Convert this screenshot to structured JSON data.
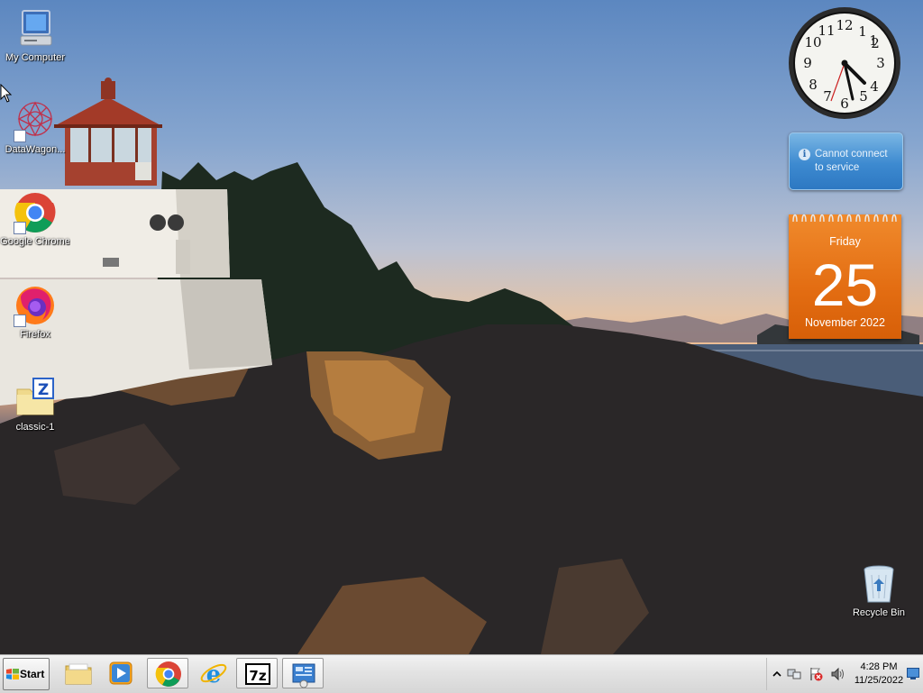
{
  "desktop": {
    "icons": [
      {
        "label": "My Computer",
        "icon": "computer-icon"
      },
      {
        "label": "DataWagon...",
        "icon": "datawagon-icon"
      },
      {
        "label": "Google Chrome",
        "icon": "chrome-icon"
      },
      {
        "label": "Firefox",
        "icon": "firefox-icon"
      },
      {
        "label": "classic-1",
        "icon": "zip-archive-icon"
      },
      {
        "label": "Recycle Bin",
        "icon": "recycle-bin-icon"
      }
    ]
  },
  "gadgets": {
    "clock": {
      "time": "4:28"
    },
    "weather": {
      "message": "Cannot connect to service",
      "icon": "info-icon"
    },
    "calendar": {
      "weekday": "Friday",
      "day": "25",
      "month_year": "November 2022"
    }
  },
  "taskbar": {
    "start_label": "Start",
    "pinned": [
      {
        "name": "Windows Explorer",
        "icon": "folder-icon"
      },
      {
        "name": "Windows Media Player",
        "icon": "media-player-icon"
      },
      {
        "name": "Google Chrome",
        "icon": "chrome-icon",
        "active": true
      },
      {
        "name": "Internet Explorer",
        "icon": "internet-explorer-icon"
      },
      {
        "name": "7-Zip",
        "icon": "sevenzip-icon",
        "active": true
      },
      {
        "name": "Control Panel",
        "icon": "control-panel-icon",
        "active": true
      }
    ],
    "tray": {
      "time": "4:28 PM",
      "date": "11/25/2022",
      "icons": [
        "show-hidden-icons-chevron",
        "network-icon",
        "action-center-flag-icon",
        "volume-icon"
      ]
    }
  }
}
